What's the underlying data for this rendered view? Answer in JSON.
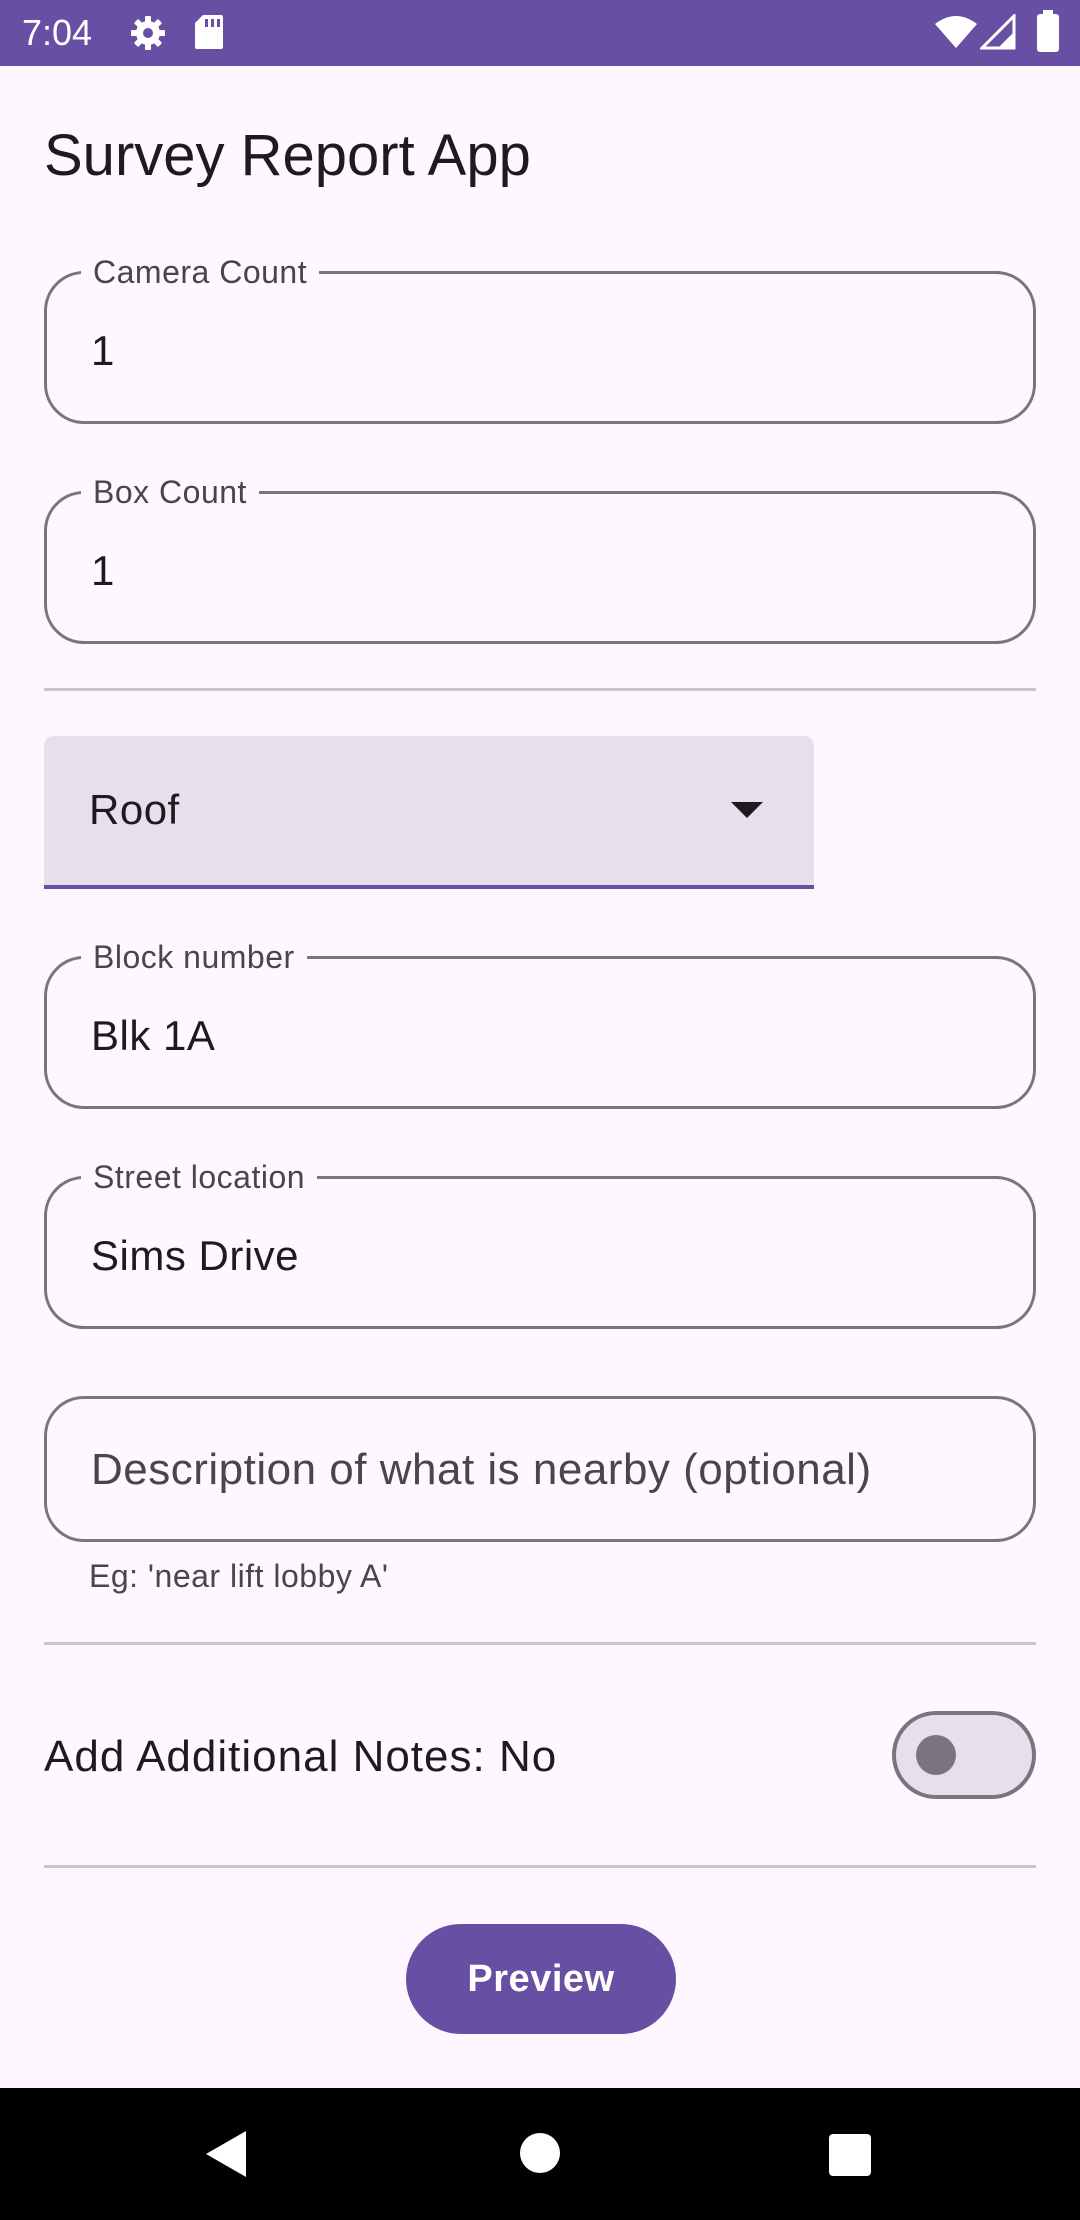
{
  "status_bar": {
    "time": "7:04",
    "icons": [
      "gear-icon",
      "sd-card-icon",
      "wifi-icon",
      "cellular-signal-icon",
      "battery-icon"
    ]
  },
  "app": {
    "title": "Survey Report App"
  },
  "fields": {
    "camera_count": {
      "label": "Camera Count",
      "value": "1"
    },
    "box_count": {
      "label": "Box Count",
      "value": "1"
    },
    "location_type": {
      "selected": "Roof"
    },
    "block_number": {
      "label": "Block number",
      "value": "Blk 1A"
    },
    "street_location": {
      "label": "Street location",
      "value": "Sims Drive"
    },
    "description": {
      "placeholder": "Description of what is nearby (optional)",
      "supporting_text": "Eg: 'near lift lobby A'"
    }
  },
  "notes_toggle": {
    "label": "Add Additional Notes: No",
    "state": "off"
  },
  "actions": {
    "preview_label": "Preview"
  },
  "nav_bar": {
    "icons": [
      "back-icon",
      "home-icon",
      "recents-icon"
    ]
  },
  "colors": {
    "primary": "#6750a4",
    "background": "#fef7ff",
    "outline": "#79747e",
    "surface_variant": "#e7e0ec"
  }
}
